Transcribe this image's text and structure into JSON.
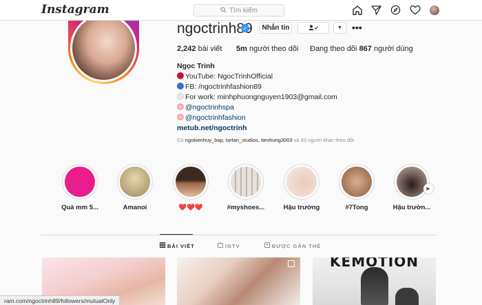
{
  "nav": {
    "logo": "Instagram",
    "search_placeholder": "Tìm kiếm",
    "icons": [
      "home-icon",
      "direct-icon",
      "explore-icon",
      "heart-icon",
      "profile-avatar"
    ]
  },
  "profile": {
    "username": "ngoctrinh89",
    "verified": true,
    "message_label": "Nhắn tin",
    "following_icon": "person-check-icon",
    "more_glyph": "•••",
    "stats": {
      "posts_value": "2,242",
      "posts_label": "bài viết",
      "followers_value": "5m",
      "followers_label": "người theo dõi",
      "following_prefix": "Đang theo dõi",
      "following_value": "867",
      "following_label": "người dùng"
    },
    "bio": {
      "name": "Ngọc Trinh",
      "youtube": "YouTube: NgocTrinhOfficial",
      "fb": "FB: /ngoctrinhfashion89",
      "work": "For work: minhphuongnguyen1903@gmail.com",
      "tag1": "@ngoctrinhspa",
      "tag2": "@ngoctrinhfashion",
      "url": "metub.net/ngoctrinh"
    },
    "mutual": {
      "prefix": "Có",
      "names": "ngokienhuy_bap, tartan_studios, tienhung3003",
      "suffix": "và 83 người khác theo dõi"
    }
  },
  "highlights": [
    {
      "label": "Quà mm 5...",
      "color": "#e91e8c"
    },
    {
      "label": "Amanoi",
      "color": "#c9b98a"
    },
    {
      "label": "❤️❤️❤️",
      "color": "#6b4a3a"
    },
    {
      "label": "#myshoes...",
      "color": "#cfc9c3"
    },
    {
      "label": "Hậu trường",
      "color": "#e9d8d0"
    },
    {
      "label": "#7Tong",
      "color": "#b98a6a"
    },
    {
      "label": "Hậu trườn...",
      "color": "#3a2a2a"
    }
  ],
  "tabs": {
    "posts": "BÀI VIẾT",
    "igtv": "IGTV",
    "tagged": "ĐƯỢC GẮN THẺ"
  },
  "posts": {
    "third_title": "KEMOTION"
  },
  "status_bar": {
    "url": "ram.com/ngoctrinh89/followers/mutualOnly"
  }
}
